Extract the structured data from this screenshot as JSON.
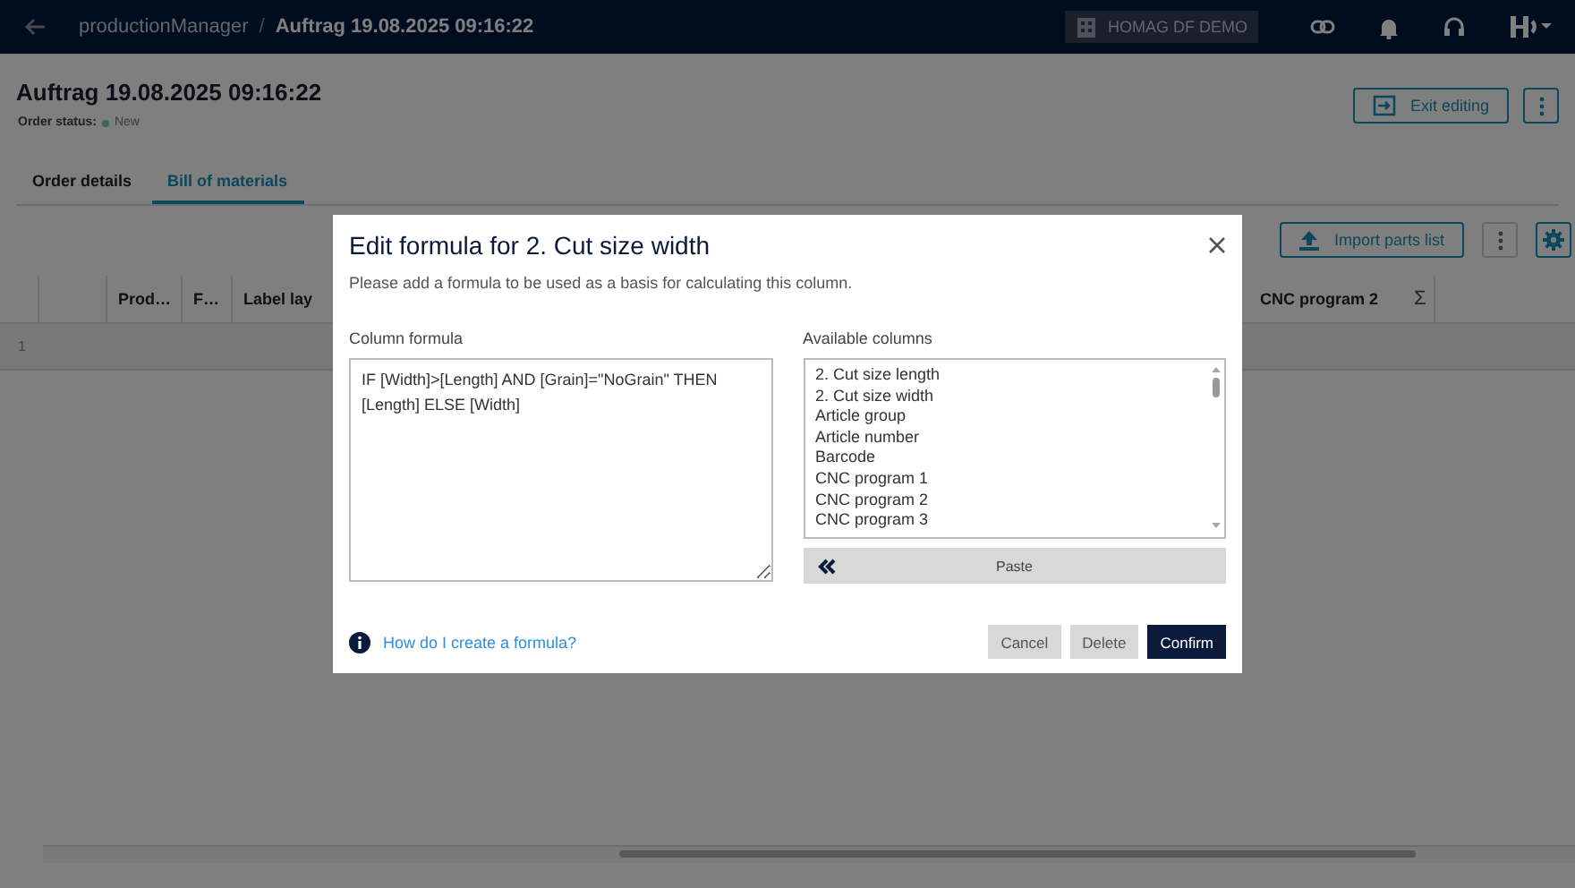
{
  "header": {
    "breadcrumb": [
      {
        "label": "productionManager",
        "current": false
      },
      {
        "label": "Auftrag 19.08.2025 09:16:22",
        "current": true
      }
    ],
    "separator": "/",
    "tenant": "HOMAG DF DEMO"
  },
  "page": {
    "title": "Auftrag 19.08.2025 09:16:22",
    "status_label": "Order status:",
    "status": {
      "text": "New",
      "color": "#3f6460"
    },
    "exit_button": "Exit editing"
  },
  "tabs": [
    {
      "label": "Order details",
      "selected": false
    },
    {
      "label": "Bill of materials",
      "selected": true
    }
  ],
  "toolbar": {
    "import_button": "Import parts list"
  },
  "table": {
    "columns_left": [
      "Prod…",
      "F…",
      "Label lay"
    ],
    "columns_right": [
      "CNC program 2"
    ],
    "sum_symbol": "Σ",
    "rows": [
      {
        "number": "1"
      }
    ]
  },
  "dialog": {
    "title": "Edit formula for 2. Cut size width",
    "description": "Please add a formula to be used as a basis for calculating this column.",
    "formula_label": "Column formula",
    "formula": "IF [Width]>[Length] AND [Grain]=\"NoGrain\" THEN [Length] ELSE [Width]",
    "columns_label": "Available columns",
    "columns": [
      {
        "label": "2. Cut size length",
        "selected": false
      },
      {
        "label": "2. Cut size width",
        "selected": false
      },
      {
        "label": "Article group",
        "selected": false
      },
      {
        "label": "Article number",
        "selected": false
      },
      {
        "label": "Barcode",
        "selected": false
      },
      {
        "label": "CNC program 1",
        "selected": false
      },
      {
        "label": "CNC program 2",
        "selected": false
      },
      {
        "label": "CNC program 3",
        "selected": false
      }
    ],
    "paste_button": "Paste",
    "help_link": "How do I create a formula?",
    "buttons": [
      {
        "label": "Cancel",
        "kind": "secondary"
      },
      {
        "label": "Delete",
        "kind": "secondary"
      },
      {
        "label": "Confirm",
        "kind": "primary"
      }
    ]
  }
}
